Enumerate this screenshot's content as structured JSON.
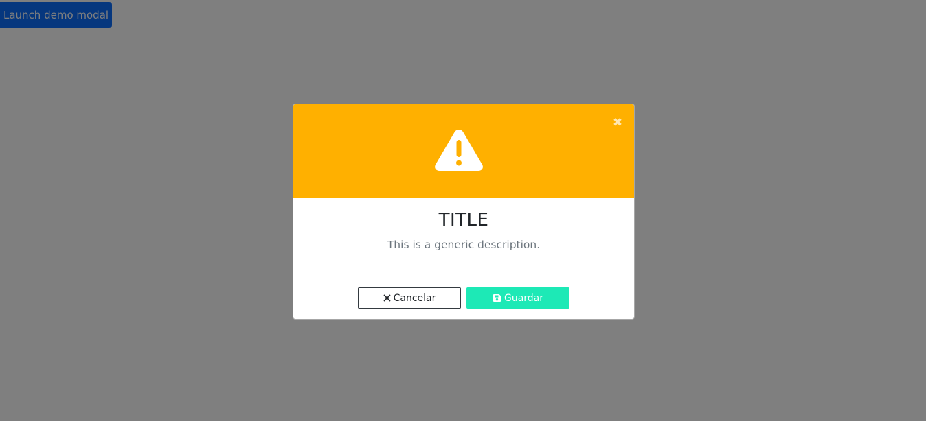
{
  "launch_button": {
    "label": "Launch demo modal"
  },
  "modal": {
    "header": {
      "icon": "warning-triangle-icon",
      "close_icon": "close-icon",
      "color": "#ffb000"
    },
    "title": "TITLE",
    "description": "This is a generic description.",
    "footer": {
      "cancel_label": "Cancelar",
      "cancel_icon": "times-icon",
      "save_label": "Guardar",
      "save_icon": "floppy-disk-icon",
      "save_color": "#1de9b6"
    }
  },
  "colors": {
    "primary": "#0d6efd",
    "warning": "#ffb000",
    "success": "#1de9b6"
  }
}
